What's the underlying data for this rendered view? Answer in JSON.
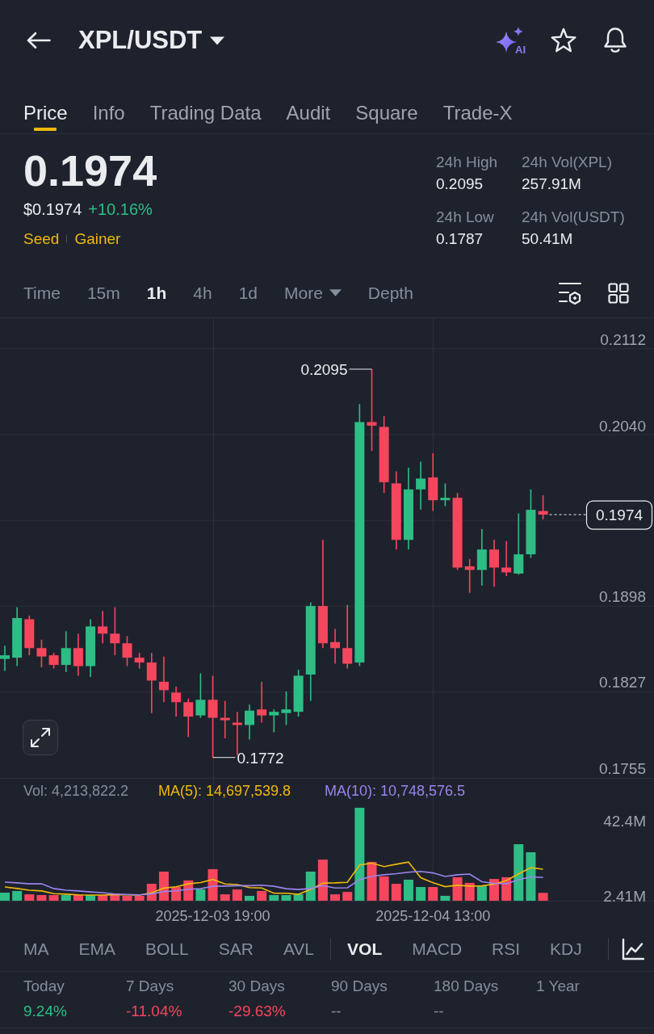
{
  "header": {
    "title": "XPL/USDT",
    "ai_label": "AI"
  },
  "tabs": [
    {
      "label": "Price",
      "selected": true
    },
    {
      "label": "Info",
      "selected": false
    },
    {
      "label": "Trading Data",
      "selected": false
    },
    {
      "label": "Audit",
      "selected": false
    },
    {
      "label": "Square",
      "selected": false
    },
    {
      "label": "Trade-X",
      "selected": false
    }
  ],
  "ticker": {
    "price": "0.1974",
    "usd_price": "$0.1974",
    "change": "+10.16%",
    "up": true,
    "tags": [
      "Seed",
      "Gainer"
    ]
  },
  "stats": [
    {
      "label": "24h High",
      "value": "0.2095"
    },
    {
      "label": "24h Vol(XPL)",
      "value": "257.91M"
    },
    {
      "label": "24h Low",
      "value": "0.1787"
    },
    {
      "label": "24h Vol(USDT)",
      "value": "50.41M"
    }
  ],
  "intervals": [
    {
      "label": "Time",
      "kind": "option",
      "selected": false
    },
    {
      "label": "15m",
      "kind": "option",
      "selected": false
    },
    {
      "label": "1h",
      "kind": "option",
      "selected": true
    },
    {
      "label": "4h",
      "kind": "option",
      "selected": false
    },
    {
      "label": "1d",
      "kind": "option",
      "selected": false
    },
    {
      "label": "More",
      "kind": "dropdown",
      "selected": false
    },
    {
      "label": "Depth",
      "kind": "option",
      "selected": false
    }
  ],
  "price_chart": {
    "high_label": "0.2095",
    "low_label": "0.1772",
    "last_label": "0.1974",
    "chart_data": {
      "type": "candlestick",
      "grid": true,
      "categories": [
        null,
        null,
        null,
        null,
        null,
        null,
        null,
        null,
        null,
        null,
        null,
        null,
        null,
        null,
        null,
        null,
        null,
        null,
        null,
        null,
        null,
        null,
        null,
        null,
        null,
        null,
        null,
        null,
        null,
        null,
        null,
        null,
        null,
        null,
        null,
        null,
        null,
        null,
        null,
        null,
        null,
        null,
        null,
        null,
        null
      ],
      "ylim": [
        0.1755,
        0.2138
      ],
      "yticks": [
        {
          "value": 0.2112,
          "label": "0.2112"
        },
        {
          "value": 0.204,
          "label": "0.2040"
        },
        {
          "value": 0.1898,
          "label": "0.1898"
        },
        {
          "value": 0.1827,
          "label": "0.1827"
        },
        {
          "value": 0.1755,
          "label": "0.1755"
        }
      ],
      "ohlc": [
        [
          0.1854,
          0.1865,
          0.1844,
          0.1857
        ],
        [
          0.1855,
          0.1897,
          0.1848,
          0.1888
        ],
        [
          0.1887,
          0.189,
          0.1857,
          0.1863
        ],
        [
          0.1863,
          0.187,
          0.1847,
          0.1856
        ],
        [
          0.1857,
          0.1859,
          0.1846,
          0.1849
        ],
        [
          0.1849,
          0.1877,
          0.1843,
          0.1863
        ],
        [
          0.1863,
          0.1875,
          0.184,
          0.1848
        ],
        [
          0.1848,
          0.1887,
          0.1839,
          0.1881
        ],
        [
          0.1881,
          0.1894,
          0.1867,
          0.1875
        ],
        [
          0.1875,
          0.1897,
          0.1857,
          0.1867
        ],
        [
          0.1867,
          0.1873,
          0.1848,
          0.1855
        ],
        [
          0.1855,
          0.1859,
          0.1846,
          0.1851
        ],
        [
          0.1851,
          0.1859,
          0.1809,
          0.1836
        ],
        [
          0.1835,
          0.1856,
          0.1818,
          0.1828
        ],
        [
          0.1826,
          0.1831,
          0.1806,
          0.1818
        ],
        [
          0.1818,
          0.1821,
          0.1789,
          0.1806
        ],
        [
          0.1807,
          0.1842,
          0.1805,
          0.182
        ],
        [
          0.182,
          0.184,
          0.1772,
          0.1805
        ],
        [
          0.1805,
          0.1819,
          0.1788,
          0.1803
        ],
        [
          0.1801,
          0.181,
          0.1774,
          0.1799
        ],
        [
          0.1799,
          0.1816,
          0.1787,
          0.1811
        ],
        [
          0.1812,
          0.1835,
          0.1801,
          0.1807
        ],
        [
          0.1807,
          0.1812,
          0.1793,
          0.181
        ],
        [
          0.1809,
          0.1827,
          0.1799,
          0.1812
        ],
        [
          0.181,
          0.1845,
          0.1806,
          0.184
        ],
        [
          0.1841,
          0.1901,
          0.1819,
          0.1898
        ],
        [
          0.1898,
          0.1953,
          0.1863,
          0.1867
        ],
        [
          0.1868,
          0.1879,
          0.185,
          0.1863
        ],
        [
          0.1863,
          0.1899,
          0.1846,
          0.185
        ],
        [
          0.1851,
          0.2066,
          0.1848,
          0.2051
        ],
        [
          0.2051,
          0.2095,
          0.2027,
          0.2048
        ],
        [
          0.2047,
          0.2056,
          0.1992,
          0.2001
        ],
        [
          0.2,
          0.201,
          0.1945,
          0.1953
        ],
        [
          0.1953,
          0.2013,
          0.1945,
          0.1995
        ],
        [
          0.1995,
          0.2018,
          0.1978,
          0.2004
        ],
        [
          0.2005,
          0.2025,
          0.1977,
          0.1986
        ],
        [
          0.1986,
          0.2,
          0.1981,
          0.1988
        ],
        [
          0.1988,
          0.1992,
          0.1928,
          0.193
        ],
        [
          0.1931,
          0.1937,
          0.1909,
          0.1928
        ],
        [
          0.1928,
          0.1962,
          0.1915,
          0.1945
        ],
        [
          0.1945,
          0.1953,
          0.1914,
          0.193
        ],
        [
          0.193,
          0.1952,
          0.1923,
          0.1926
        ],
        [
          0.1925,
          0.1975,
          0.1924,
          0.1941
        ],
        [
          0.1941,
          0.1995,
          0.1938,
          0.1978
        ],
        [
          0.1977,
          0.199,
          0.197,
          0.1974
        ]
      ]
    }
  },
  "volume": {
    "readings": [
      {
        "text": "Vol: 4,213,822.2",
        "color": "#848e9c"
      },
      {
        "text": "MA(5): 14,697,539.8",
        "color": "#f0b90b"
      },
      {
        "text": "MA(10): 10,748,576.5",
        "color": "#9b84ee"
      }
    ],
    "chart_data": {
      "type": "bar",
      "grid": true,
      "categories": [
        null,
        null,
        null,
        null,
        null,
        null,
        null,
        null,
        null,
        null,
        null,
        null,
        null,
        null,
        null,
        null,
        null,
        "2025-12-03 19:00",
        null,
        null,
        null,
        null,
        null,
        null,
        null,
        null,
        null,
        null,
        null,
        null,
        null,
        null,
        null,
        null,
        null,
        "2025-12-04 13:00",
        null,
        null,
        null,
        null,
        null,
        null,
        null,
        null,
        null
      ],
      "ylim": [
        0,
        65.4
      ],
      "yticks": [
        {
          "value": 2.41,
          "label": "2.41M"
        },
        {
          "value": 42.4,
          "label": "42.4M"
        }
      ],
      "series": [
        {
          "values": [
            4.3,
            5.2,
            3.4,
            3.0,
            3.0,
            3.0,
            3.0,
            3.0,
            3.0,
            3.9,
            2.6,
            2.6,
            9.0,
            15.5,
            7.3,
            10.8,
            6.0,
            16.8,
            3.4,
            6.0,
            2.6,
            5.2,
            3.0,
            3.0,
            3.4,
            15.5,
            21.9,
            3.4,
            4.7,
            49.5,
            20.7,
            12.9,
            9.0,
            11.2,
            7.3,
            7.3,
            2.6,
            12.5,
            9.5,
            7.7,
            11.6,
            12.5,
            30.1,
            25.8,
            4.2
          ],
          "colors": [
            "#2ebd85",
            "#2ebd85",
            "#f6465d",
            "#f6465d",
            "#f6465d",
            "#2ebd85",
            "#f6465d",
            "#2ebd85",
            "#f6465d",
            "#f6465d",
            "#f6465d",
            "#f6465d",
            "#f6465d",
            "#f6465d",
            "#f6465d",
            "#f6465d",
            "#2ebd85",
            "#f6465d",
            "#f6465d",
            "#f6465d",
            "#2ebd85",
            "#f6465d",
            "#2ebd85",
            "#2ebd85",
            "#2ebd85",
            "#2ebd85",
            "#f6465d",
            "#f6465d",
            "#f6465d",
            "#2ebd85",
            "#f6465d",
            "#f6465d",
            "#f6465d",
            "#2ebd85",
            "#2ebd85",
            "#f6465d",
            "#2ebd85",
            "#f6465d",
            "#f6465d",
            "#2ebd85",
            "#f6465d",
            "#f6465d",
            "#2ebd85",
            "#2ebd85",
            "#f6465d"
          ]
        },
        {
          "type": "line",
          "color": "#f0b90b",
          "values": [
            7.3,
            6.5,
            5.6,
            5.2,
            3.8,
            3.5,
            3.1,
            3.0,
            3.0,
            3.2,
            3.1,
            3.0,
            4.2,
            6.7,
            7.4,
            9.0,
            9.7,
            11.3,
            8.9,
            8.6,
            7.0,
            6.8,
            4.0,
            4.0,
            3.4,
            6.0,
            9.4,
            9.5,
            9.8,
            19.0,
            20.0,
            18.2,
            19.4,
            20.6,
            12.2,
            9.6,
            7.5,
            8.2,
            7.8,
            7.9,
            8.8,
            10.8,
            14.3,
            17.6,
            16.8
          ]
        },
        {
          "type": "line",
          "color": "#9b84ee",
          "values": [
            9.9,
            9.5,
            9.0,
            9.0,
            6.5,
            5.6,
            5.2,
            4.7,
            4.3,
            3.5,
            3.3,
            3.1,
            3.6,
            4.9,
            5.3,
            6.1,
            6.4,
            7.7,
            7.8,
            8.0,
            8.0,
            8.3,
            7.7,
            6.4,
            6.0,
            6.5,
            8.1,
            6.8,
            6.9,
            11.2,
            13.0,
            13.8,
            14.4,
            15.2,
            15.6,
            14.8,
            12.9,
            13.8,
            14.2,
            10.1,
            9.2,
            9.1,
            11.2,
            12.7,
            12.4
          ]
        }
      ]
    }
  },
  "indicators": {
    "main": [
      {
        "label": "MA",
        "selected": false
      },
      {
        "label": "EMA",
        "selected": false
      },
      {
        "label": "BOLL",
        "selected": false
      },
      {
        "label": "SAR",
        "selected": false
      },
      {
        "label": "AVL",
        "selected": false
      }
    ],
    "sub": [
      {
        "label": "VOL",
        "selected": true
      },
      {
        "label": "MACD",
        "selected": false
      },
      {
        "label": "RSI",
        "selected": false
      },
      {
        "label": "KDJ",
        "selected": false
      }
    ]
  },
  "performance": [
    {
      "label": "Today",
      "value": "9.24%",
      "color": "#2ebd85"
    },
    {
      "label": "7 Days",
      "value": "-11.04%",
      "color": "#f6465d"
    },
    {
      "label": "30 Days",
      "value": "-29.63%",
      "color": "#f6465d"
    },
    {
      "label": "90 Days",
      "value": "--",
      "color": "#848e9c"
    },
    {
      "label": "180 Days",
      "value": "--",
      "color": "#848e9c"
    },
    {
      "label": "1 Year"
    }
  ]
}
